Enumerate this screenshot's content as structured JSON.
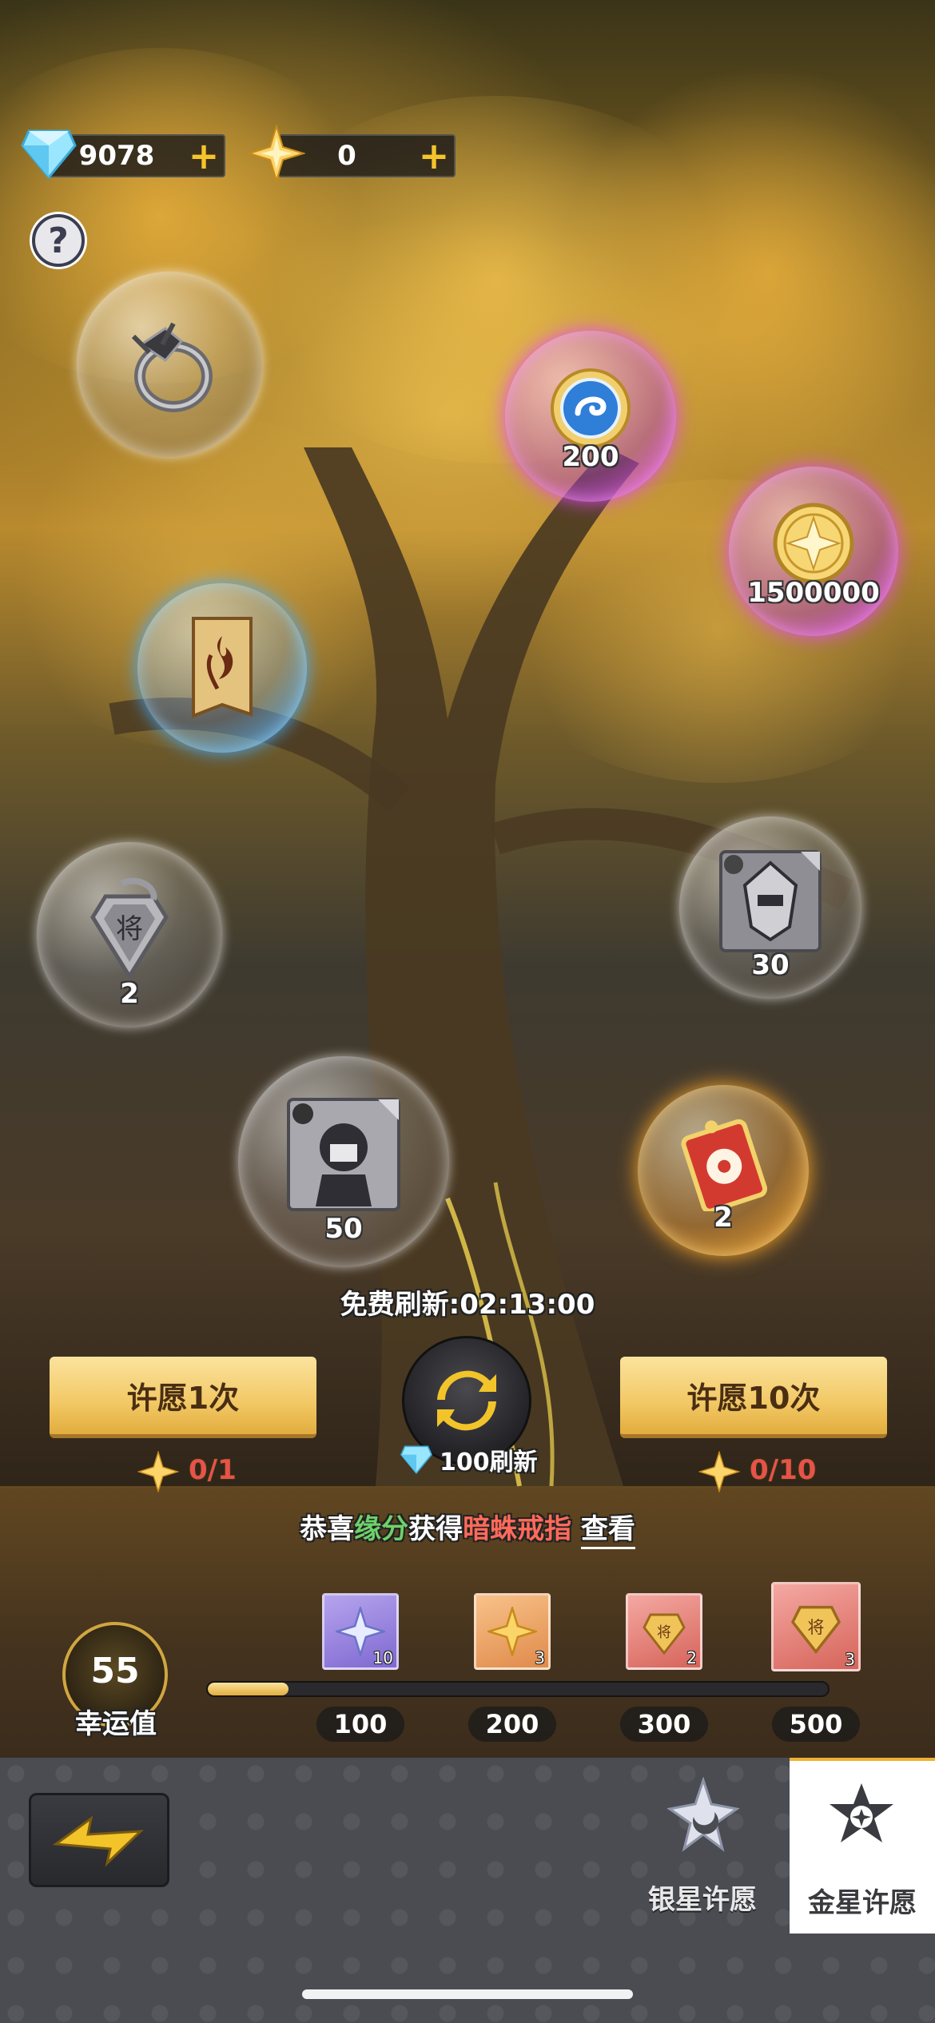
{
  "currency": {
    "diamond": {
      "value": "9078",
      "icon": "diamond-icon"
    },
    "gold_star": {
      "value": "0",
      "icon": "gold-star-icon"
    },
    "plus_label": "+"
  },
  "help": {
    "label": "?"
  },
  "bubbles": [
    {
      "name": "spider-ring-bubble",
      "icon": "ring-icon",
      "count": ""
    },
    {
      "name": "blue-token-bubble",
      "icon": "swirl-coin-icon",
      "count": "200"
    },
    {
      "name": "gold-coin-bubble",
      "icon": "star-coin-icon",
      "count": "1500000"
    },
    {
      "name": "scroll-bubble",
      "icon": "flame-scroll-icon",
      "count": ""
    },
    {
      "name": "general-token-bubble",
      "icon": "general-badge-icon",
      "count": "2"
    },
    {
      "name": "armor-fragment-bubble",
      "icon": "armor-fragment-icon",
      "count": "30"
    },
    {
      "name": "hero-fragment-bubble",
      "icon": "hero-fragment-icon",
      "count": "50"
    },
    {
      "name": "red-ticket-bubble",
      "icon": "flower-ticket-icon",
      "count": "2"
    }
  ],
  "wish": {
    "free_refresh": "免费刷新:02:13:00",
    "wish_once": "许愿1次",
    "wish_ten": "许愿10次",
    "refresh_cost": "100刷新",
    "once_progress": "0/1",
    "ten_progress": "0/10"
  },
  "announcement": {
    "prefix": "恭喜",
    "player": "缘分",
    "middle": "获得",
    "item": "暗蛛戒指",
    "view": "查看"
  },
  "luck": {
    "value": "55",
    "label": "幸运值",
    "progress_fraction": 0.13,
    "milestones": [
      {
        "threshold": "100",
        "reward_icon": "silver-star-icon",
        "qty": "10"
      },
      {
        "threshold": "200",
        "reward_icon": "gold-star-icon",
        "qty": "3"
      },
      {
        "threshold": "300",
        "reward_icon": "general-token-icon",
        "qty": "2"
      },
      {
        "threshold": "500",
        "reward_icon": "general-token-icon",
        "qty": "3"
      }
    ]
  },
  "tabs": [
    {
      "label": "银星许愿",
      "active": false,
      "icon": "silver-star-moon-icon"
    },
    {
      "label": "金星许愿",
      "active": true,
      "icon": "gold-star-emblem-icon"
    }
  ],
  "back": {
    "icon": "back-arrow-icon"
  },
  "colors": {
    "accent_gold": "#f2c865",
    "progress_red": "#e8524a",
    "highlight_green": "#6ed16a"
  }
}
